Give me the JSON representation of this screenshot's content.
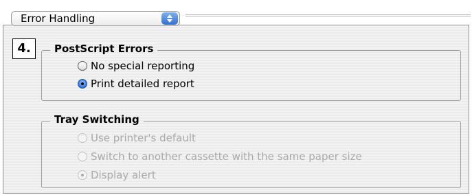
{
  "header": {
    "popup_value": "Error Handling"
  },
  "step_badge": "4.",
  "postscript_errors": {
    "title": "PostScript Errors",
    "options": [
      {
        "label": "No special reporting",
        "selected": false
      },
      {
        "label": "Print detailed report",
        "selected": true
      }
    ]
  },
  "tray_switching": {
    "title": "Tray Switching",
    "enabled": false,
    "options": [
      {
        "label": "Use printer's default",
        "selected": false
      },
      {
        "label": "Switch to another cassette with the same paper size",
        "selected": false
      },
      {
        "label": "Display alert",
        "selected": true
      }
    ]
  }
}
